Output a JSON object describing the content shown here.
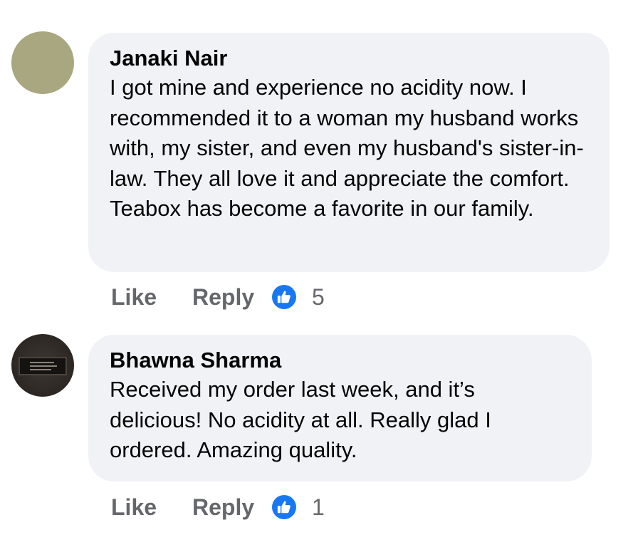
{
  "comments": [
    {
      "author": "Janaki Nair",
      "text": "I got mine and experience no acidity now. I recommended it to a woman my husband works with, my sister, and even my husband's sister-in-law. They all love it and appreciate the comfort. Teabox has become a favorite in our family.",
      "actions": {
        "like_label": "Like",
        "reply_label": "Reply",
        "reaction_icon": "thumbs-up-icon",
        "like_count": "5"
      }
    },
    {
      "author": "Bhawna Sharma",
      "text": "Received my order last week, and it’s delicious! No acidity at all. Really glad I ordered. Amazing quality.",
      "actions": {
        "like_label": "Like",
        "reply_label": "Reply",
        "reaction_icon": "thumbs-up-icon",
        "like_count": "1"
      }
    }
  ],
  "colors": {
    "bubble_background": "#f0f2f5",
    "like_badge": "#1877f2",
    "secondary_text": "#65676b",
    "primary_text": "#050505"
  }
}
